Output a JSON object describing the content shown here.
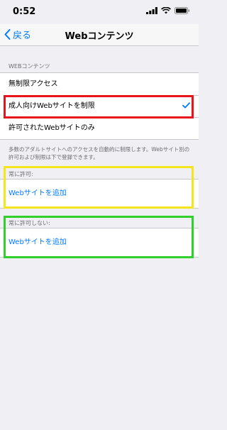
{
  "status": {
    "time": "0:52"
  },
  "nav": {
    "back_label": "戻る",
    "title": "Webコンテンツ"
  },
  "content_section": {
    "header": "WEBコンテンツ",
    "options": [
      {
        "label": "無制限アクセス",
        "selected": false
      },
      {
        "label": "成人向けWebサイトを制限",
        "selected": true
      },
      {
        "label": "許可されたWebサイトのみ",
        "selected": false
      }
    ],
    "footer": "多数のアダルトサイトへのアクセスを自動的に制限します。Webサイト別の許可および制限は下で登録できます。"
  },
  "always_allow": {
    "header": "常に許可:",
    "add_label": "Webサイトを追加"
  },
  "never_allow": {
    "header": "常に許可しない:",
    "add_label": "Webサイトを追加"
  },
  "colors": {
    "accent": "#007aff",
    "highlight_red": "#e8141b",
    "highlight_yellow": "#f5e51c",
    "highlight_green": "#2fd12a"
  }
}
